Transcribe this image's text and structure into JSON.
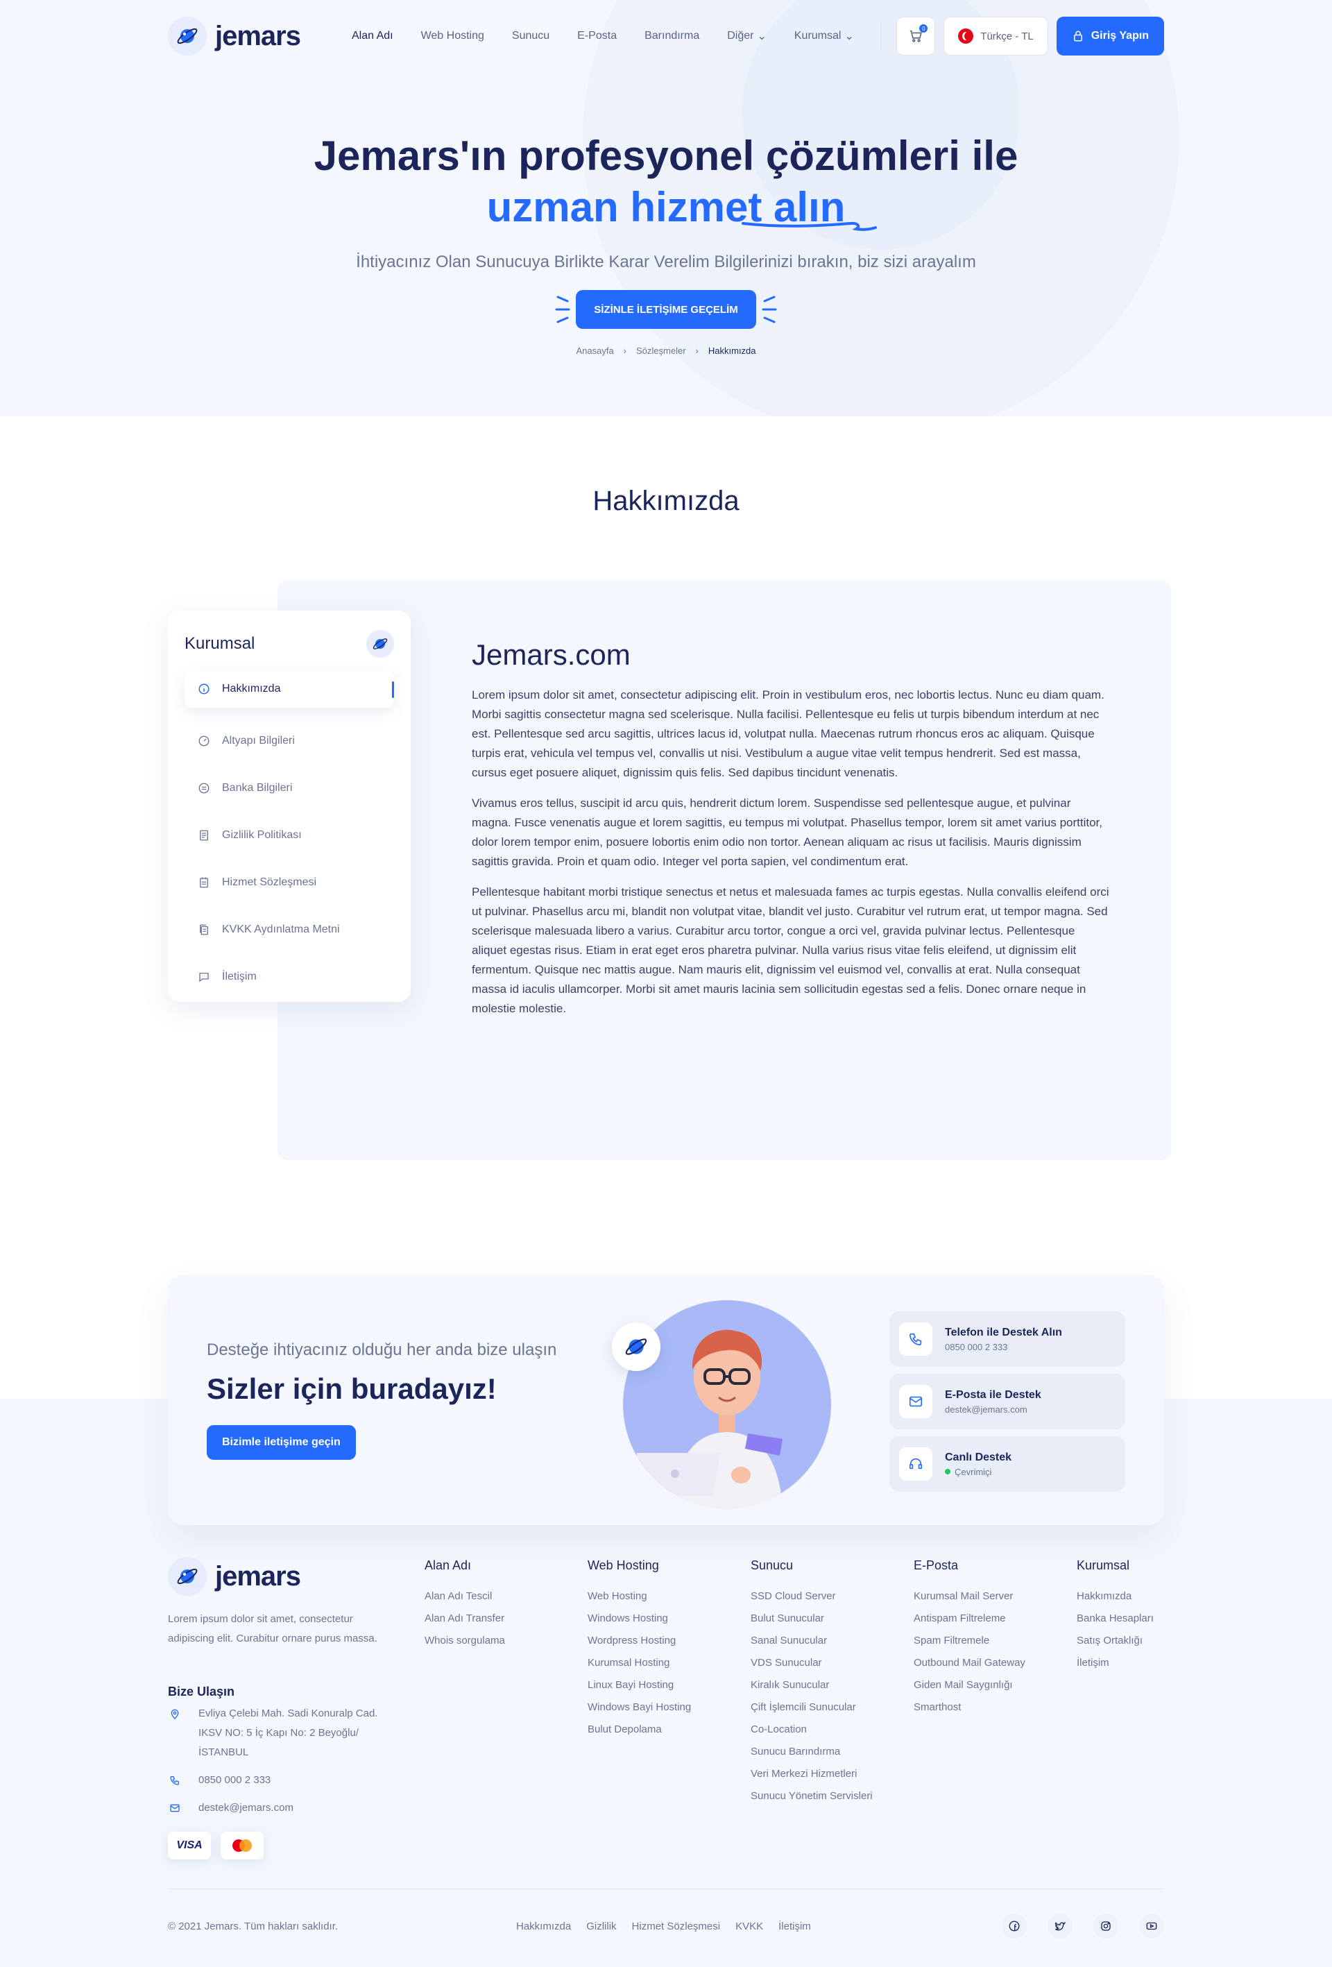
{
  "brand": {
    "name": "jemars",
    "accent": "#246bfd",
    "dark": "#1b2559"
  },
  "nav": {
    "items": [
      {
        "label": "Alan Adı",
        "dropdown": false
      },
      {
        "label": "Web Hosting",
        "dropdown": false
      },
      {
        "label": "Sunucu",
        "dropdown": false
      },
      {
        "label": "E-Posta",
        "dropdown": false
      },
      {
        "label": "Barındırma",
        "dropdown": false
      },
      {
        "label": "Diğer",
        "dropdown": true
      },
      {
        "label": "Kurumsal",
        "dropdown": true
      }
    ],
    "cart_count": "0",
    "language": "Türkçe - TL",
    "login_label": "Giriş Yapın"
  },
  "hero": {
    "title_line1": "Jemars'ın profesyonel çözümleri ile",
    "title_line2": "uzman hizmet alın",
    "subtitle": "İhtiyacınız Olan Sunucuya Birlikte Karar Verelim Bilgilerinizi bırakın, biz sizi arayalım",
    "cta": "SİZİNLE İLETİŞİME GEÇELİM",
    "breadcrumbs": [
      "Anasayfa",
      "Sözleşmeler",
      "Hakkımızda"
    ]
  },
  "section_title": "Hakkımızda",
  "sidebar": {
    "title": "Kurumsal",
    "items": [
      {
        "label": "Hakkımızda",
        "icon": "info-icon",
        "active": true
      },
      {
        "label": "Altyapı Bilgileri",
        "icon": "gauge-icon",
        "active": false
      },
      {
        "label": "Banka Bilgileri",
        "icon": "bank-icon",
        "active": false
      },
      {
        "label": "Gizlilik Politikası",
        "icon": "document-icon",
        "active": false
      },
      {
        "label": "Hizmet Sözleşmesi",
        "icon": "contract-icon",
        "active": false
      },
      {
        "label": "KVKK Aydınlatma Metni",
        "icon": "copy-icon",
        "active": false
      },
      {
        "label": "İletişim",
        "icon": "chat-icon",
        "active": false
      }
    ]
  },
  "article": {
    "title": "Jemars.com",
    "paragraphs": [
      "Lorem ipsum dolor sit amet, consectetur adipiscing elit. Proin in vestibulum eros, nec lobortis lectus. Nunc eu diam quam. Morbi sagittis consectetur magna sed scelerisque. Nulla facilisi. Pellentesque eu felis ut turpis bibendum interdum at nec est. Pellentesque sed arcu sagittis, ultrices lacus id, volutpat nulla. Maecenas rutrum rhoncus eros ac aliquam. Quisque turpis erat, vehicula vel tempus vel, convallis ut nisi. Vestibulum a augue vitae velit tempus hendrerit. Sed est massa, cursus eget posuere aliquet, dignissim quis felis. Sed dapibus tincidunt venenatis.",
      "Vivamus eros tellus, suscipit id arcu quis, hendrerit dictum lorem. Suspendisse sed pellentesque augue, et pulvinar magna. Fusce venenatis augue et lorem sagittis, eu tempus mi volutpat. Phasellus tempor, lorem sit amet varius porttitor, dolor lorem tempor enim, posuere lobortis enim odio non tortor. Aenean aliquam ac risus ut facilisis. Mauris dignissim sagittis gravida. Proin et quam odio. Integer vel porta sapien, vel condimentum erat.",
      "Pellentesque habitant morbi tristique senectus et netus et malesuada fames ac turpis egestas. Nulla convallis eleifend orci ut pulvinar. Phasellus arcu mi, blandit non volutpat vitae, blandit vel justo. Curabitur vel rutrum erat, ut tempor magna. Sed scelerisque malesuada libero a varius. Curabitur arcu tortor, congue a orci vel, gravida pulvinar lectus. Pellentesque aliquet egestas risus. Etiam in erat eget eros pharetra pulvinar. Nulla varius risus vitae felis eleifend, ut dignissim elit fermentum. Quisque nec mattis augue. Nam mauris elit, dignissim vel euismod vel, convallis at erat. Nulla consequat massa id iaculis ullamcorper. Morbi sit amet mauris lacinia sem sollicitudin egestas sed a felis. Donec ornare neque in molestie molestie."
    ]
  },
  "support": {
    "small": "Desteğe ihtiyacınız olduğu her anda bize ulaşın",
    "big": "Sizler için buradayız!",
    "button": "Bizimle iletişime geçin",
    "cards": [
      {
        "title": "Telefon ile Destek Alın",
        "sub": "0850 000 2 333",
        "icon": "phone-icon"
      },
      {
        "title": "E-Posta ile Destek",
        "sub": "destek@jemars.com",
        "icon": "mail-icon"
      },
      {
        "title": "Canlı Destek",
        "sub": "Çevrimiçi",
        "icon": "headset-icon"
      }
    ]
  },
  "footer": {
    "desc": "Lorem ipsum dolor sit amet, consectetur adipiscing elit. Curabitur ornare purus massa.",
    "reach_title": "Bize Ulaşın",
    "address": "Evliya Çelebi Mah. Sadi Konuralp Cad. IKSV NO: 5 İç Kapı No: 2 Beyoğlu/İSTANBUL",
    "phone": "0850 000 2 333",
    "email": "destek@jemars.com",
    "payments": [
      "VISA",
      "mastercard"
    ],
    "columns": [
      {
        "title": "Alan Adı",
        "links": [
          "Alan Adı Tescil",
          "Alan Adı Transfer",
          "Whois sorgulama"
        ]
      },
      {
        "title": "Web Hosting",
        "links": [
          "Web Hosting",
          "Windows Hosting",
          "Wordpress Hosting",
          "Kurumsal Hosting",
          "Linux Bayi Hosting",
          "Windows Bayi Hosting",
          "Bulut Depolama"
        ]
      },
      {
        "title": "Sunucu",
        "links": [
          "SSD Cloud Server",
          "Bulut Sunucular",
          "Sanal Sunucular",
          "VDS Sunucular",
          "Kiralık Sunucular",
          "Çift İşlemcili Sunucular",
          "Co-Location",
          "Sunucu Barındırma",
          "Veri Merkezi Hizmetleri",
          "Sunucu Yönetim Servisleri"
        ]
      },
      {
        "title": "E-Posta",
        "links": [
          "Kurumsal Mail Server",
          "Antispam Filtreleme",
          "Spam Filtremele",
          "Outbound Mail Gateway",
          "Giden Mail Saygınlığı",
          "Smarthost"
        ]
      },
      {
        "title": "Kurumsal",
        "links": [
          "Hakkımızda",
          "Banka Hesapları",
          "Satış Ortaklığı",
          "İletişim"
        ]
      }
    ],
    "copyright": "© 2021 Jemars. Tüm hakları saklıdır.",
    "bottom_links": [
      "Hakkımızda",
      "Gizlilik",
      "Hizmet Sözleşmesi",
      "KVKK",
      "İletişim"
    ],
    "social": [
      "facebook-icon",
      "twitter-icon",
      "instagram-icon",
      "youtube-icon"
    ]
  }
}
